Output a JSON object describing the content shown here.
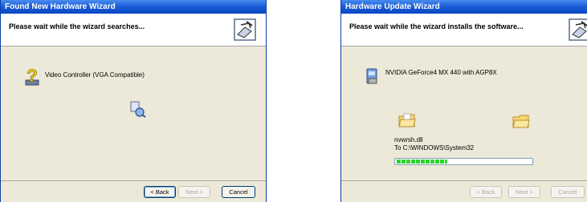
{
  "left_window": {
    "title": "Found New Hardware Wizard",
    "header_text": "Please wait while the wizard searches...",
    "device_name": "Video Controller (VGA Compatible)",
    "buttons": {
      "back": "< Back",
      "next": "Next >",
      "cancel": "Cancel"
    },
    "icons": [
      "hardware-wizard-icon",
      "unknown-device-question-icon",
      "search-flashlight-icon"
    ]
  },
  "right_window": {
    "title": "Hardware Update Wizard",
    "header_text": "Please wait while the wizard installs the software...",
    "device_name": "NVIDIA GeForce4 MX 440 with AGP8X",
    "file_name": "nvwrsh.dll",
    "destination": "To C:\\WINDOWS\\System32",
    "progress": 0.38,
    "buttons": {
      "back": "< Back",
      "next": "Next >",
      "cancel": "Cancel"
    },
    "icons": [
      "hardware-wizard-icon",
      "display-adapter-icon",
      "source-folder-icon",
      "destination-folder-icon"
    ]
  },
  "colors": {
    "titlebar": "#0a47c4",
    "dialog_bg": "#ece9d8",
    "progress_green": "#2ad52a"
  }
}
